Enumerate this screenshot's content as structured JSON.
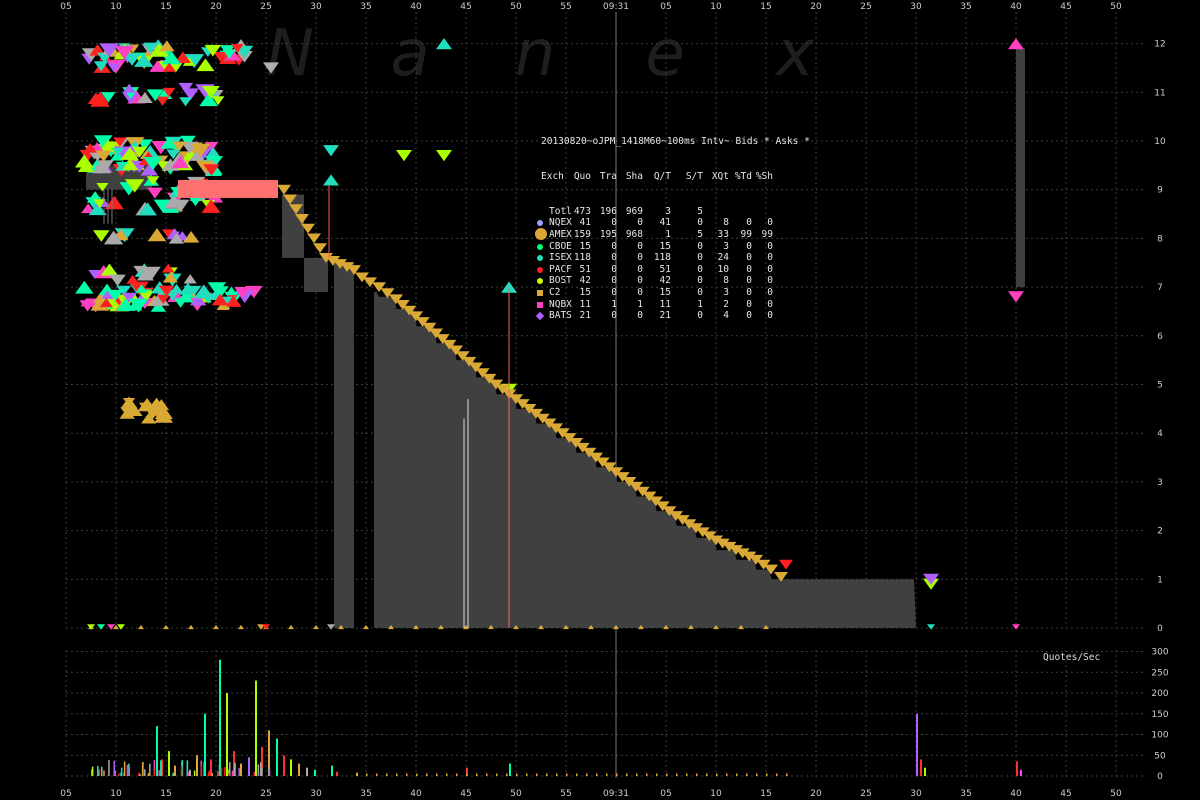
{
  "colors": {
    "background": "#000000",
    "grid": "#3c3c3c",
    "nbbo": "#404040",
    "amex": "#d9a835",
    "axis_text": "#cfcfcf",
    "watermark": "#1e1e1e"
  },
  "watermark": [
    "N",
    "a",
    "n",
    "e",
    "x"
  ],
  "cursor_time": "09:31",
  "quotes_label": "Quotes/Sec",
  "chart_data": [
    {
      "type": "scatter",
      "title": "20130820~oJPM_1418M60~100ms Intv~ Bids * Asks *",
      "x_tick_labels": [
        "05",
        "10",
        "15",
        "20",
        "25",
        "30",
        "35",
        "40",
        "45",
        "50",
        "55",
        "09:31",
        "05",
        "10",
        "15",
        "20",
        "25",
        "30",
        "35",
        "40",
        "45",
        "50"
      ],
      "y_tick_labels": [
        "0",
        "1",
        "2",
        "3",
        "4",
        "5",
        "6",
        "7",
        "8",
        "9",
        "10",
        "11",
        "12"
      ],
      "ylim": [
        0,
        12
      ],
      "grid": true,
      "nbbo_blocks": [
        {
          "x0": 2.0,
          "x1": 8.6,
          "ylo": 9.0,
          "yhi": 9.5
        },
        {
          "x0": 21.6,
          "x1": 23.8,
          "ylo": 7.6,
          "yhi": 8.9
        },
        {
          "x0": 23.8,
          "x1": 26.2,
          "ylo": 6.9,
          "yhi": 7.6
        },
        {
          "x0": 26.8,
          "x1": 28.8,
          "ylo": 0.0,
          "yhi": 7.5
        },
        {
          "x0": 30.8,
          "x1": 85.0,
          "ylo": 0.0,
          "yhi": "stair"
        },
        {
          "x0": 95.0,
          "x1": 95.9,
          "ylo": 7.0,
          "yhi": 11.9
        }
      ],
      "amex_ask_stair": [
        [
          21.8,
          9.0
        ],
        [
          22.4,
          8.8
        ],
        [
          23.0,
          8.6
        ],
        [
          23.6,
          8.4
        ],
        [
          24.2,
          8.2
        ],
        [
          24.8,
          8.0
        ],
        [
          25.4,
          7.8
        ],
        [
          26.0,
          7.6
        ],
        [
          28.8,
          7.35
        ],
        [
          29.6,
          7.2
        ],
        [
          30.4,
          7.1
        ],
        [
          31.3,
          7.0
        ],
        [
          33.0,
          6.75
        ],
        [
          35.0,
          6.4
        ],
        [
          37.0,
          6.05
        ],
        [
          39.0,
          5.7
        ],
        [
          41.0,
          5.35
        ],
        [
          43.0,
          5.0
        ],
        [
          45.0,
          4.7
        ],
        [
          47.0,
          4.4
        ],
        [
          49.0,
          4.1
        ],
        [
          51.0,
          3.8
        ],
        [
          53.0,
          3.5
        ],
        [
          55.0,
          3.2
        ],
        [
          57.0,
          2.9
        ],
        [
          59.0,
          2.6
        ],
        [
          61.0,
          2.3
        ],
        [
          63.0,
          2.05
        ],
        [
          65.0,
          1.8
        ],
        [
          67.0,
          1.6
        ],
        [
          69.0,
          1.4
        ],
        [
          70.5,
          1.2
        ],
        [
          71.5,
          1.05
        ]
      ],
      "spikes": [
        {
          "x": 26.3,
          "y0": 7.6,
          "y1": 9.1,
          "color": "#ff5555"
        },
        {
          "x": 39.8,
          "y0": 0.0,
          "y1": 4.3,
          "color": "#dddddd"
        },
        {
          "x": 40.2,
          "y0": 0.0,
          "y1": 4.7,
          "color": "#dddddd"
        },
        {
          "x": 44.3,
          "y0": 0.0,
          "y1": 7.0,
          "color": "#ff6060"
        }
      ]
    },
    {
      "type": "bar",
      "title": "Quotes/Sec",
      "ylabel": "Quotes/Sec",
      "y_tick_labels": [
        "0",
        "50",
        "100",
        "150",
        "200",
        "250",
        "300"
      ],
      "ylim": [
        0,
        300
      ],
      "bars": [
        {
          "x": 9.0,
          "v": 120,
          "c": "#00ffaa"
        },
        {
          "x": 9.5,
          "v": 40,
          "c": "#ff3030"
        },
        {
          "x": 10.2,
          "v": 60,
          "c": "#aaff00"
        },
        {
          "x": 10.8,
          "v": 25,
          "c": "#d9a835"
        },
        {
          "x": 11.5,
          "v": 35,
          "c": "#ff3030"
        },
        {
          "x": 12.3,
          "v": 15,
          "c": "#aaaaaa"
        },
        {
          "x": 13.0,
          "v": 50,
          "c": "#d9a835"
        },
        {
          "x": 13.8,
          "v": 150,
          "c": "#00ffaa"
        },
        {
          "x": 14.4,
          "v": 40,
          "c": "#ff3030"
        },
        {
          "x": 15.3,
          "v": 280,
          "c": "#00ffaa"
        },
        {
          "x": 16.0,
          "v": 200,
          "c": "#aaff00"
        },
        {
          "x": 16.7,
          "v": 60,
          "c": "#ff3030"
        },
        {
          "x": 17.4,
          "v": 30,
          "c": "#d9a835"
        },
        {
          "x": 18.2,
          "v": 45,
          "c": "#b060ff"
        },
        {
          "x": 18.9,
          "v": 230,
          "c": "#aaff00"
        },
        {
          "x": 19.5,
          "v": 70,
          "c": "#ff3030"
        },
        {
          "x": 20.2,
          "v": 110,
          "c": "#d9a835"
        },
        {
          "x": 21.0,
          "v": 90,
          "c": "#00ffaa"
        },
        {
          "x": 21.7,
          "v": 50,
          "c": "#ff3030"
        },
        {
          "x": 22.4,
          "v": 40,
          "c": "#aaff00"
        },
        {
          "x": 23.2,
          "v": 30,
          "c": "#d9a835"
        },
        {
          "x": 24.0,
          "v": 20,
          "c": "#aaaaaa"
        },
        {
          "x": 24.8,
          "v": 15,
          "c": "#00ffaa"
        },
        {
          "x": 26.5,
          "v": 25,
          "c": "#00ffaa"
        },
        {
          "x": 27.0,
          "v": 10,
          "c": "#ff3030"
        },
        {
          "x": 29.0,
          "v": 8,
          "c": "#d9a835"
        },
        {
          "x": 40.0,
          "v": 20,
          "c": "#ff3030"
        },
        {
          "x": 44.3,
          "v": 30,
          "c": "#00ffaa"
        },
        {
          "x": 85.0,
          "v": 150,
          "c": "#b060ff"
        },
        {
          "x": 85.4,
          "v": 40,
          "c": "#ff3030"
        },
        {
          "x": 85.8,
          "v": 20,
          "c": "#aaff00"
        },
        {
          "x": 95.0,
          "v": 35,
          "c": "#ff3030"
        },
        {
          "x": 95.4,
          "v": 15,
          "c": "#ff40ff"
        }
      ],
      "baseline_ticks": {
        "from": 30.0,
        "to": 72.0,
        "step": 1.0,
        "v": 6,
        "c": "#d9a835"
      }
    }
  ],
  "stats_table": {
    "title": "20130820~oJPM_1418M60~100ms Intv~ Bids * Asks *",
    "header": [
      "Exch",
      "Quo",
      "Tra",
      "Sha",
      "Q/T",
      "S/T",
      "XQt",
      "%Td",
      "%Sh"
    ],
    "rows": [
      {
        "name": "Totl",
        "marker": "",
        "shape": "none",
        "vals": [
          "473",
          "196",
          "969",
          "3",
          "5",
          "",
          "",
          ""
        ]
      },
      {
        "name": "NQEX",
        "marker": "#a0a0ff",
        "shape": "dot",
        "vals": [
          "41",
          "0",
          "0",
          "41",
          "0",
          "8",
          "0",
          "0"
        ]
      },
      {
        "name": "AMEX",
        "marker": "#d9a835",
        "shape": "big",
        "vals": [
          "159",
          "195",
          "968",
          "1",
          "5",
          "33",
          "99",
          "99"
        ]
      },
      {
        "name": "CBOE",
        "marker": "#00ff66",
        "shape": "dot",
        "vals": [
          "15",
          "0",
          "0",
          "15",
          "0",
          "3",
          "0",
          "0"
        ]
      },
      {
        "name": "ISEX",
        "marker": "#20ddc0",
        "shape": "dot",
        "vals": [
          "118",
          "0",
          "0",
          "118",
          "0",
          "24",
          "0",
          "0"
        ]
      },
      {
        "name": "PACF",
        "marker": "#ff2020",
        "shape": "dot",
        "vals": [
          "51",
          "0",
          "0",
          "51",
          "0",
          "10",
          "0",
          "0"
        ]
      },
      {
        "name": "BOST",
        "marker": "#c8ff00",
        "shape": "dot",
        "vals": [
          "42",
          "0",
          "0",
          "42",
          "0",
          "8",
          "0",
          "0"
        ]
      },
      {
        "name": "C2",
        "marker": "#d9a835",
        "shape": "sq",
        "vals": [
          "15",
          "0",
          "0",
          "15",
          "0",
          "3",
          "0",
          "0"
        ]
      },
      {
        "name": "NQBX",
        "marker": "#ff40c0",
        "shape": "sq",
        "vals": [
          "11",
          "1",
          "1",
          "11",
          "1",
          "2",
          "0",
          "0"
        ]
      },
      {
        "name": "BATS",
        "marker": "#b060ff",
        "shape": "dia",
        "vals": [
          "21",
          "0",
          "0",
          "21",
          "0",
          "4",
          "0",
          "0"
        ]
      }
    ]
  }
}
